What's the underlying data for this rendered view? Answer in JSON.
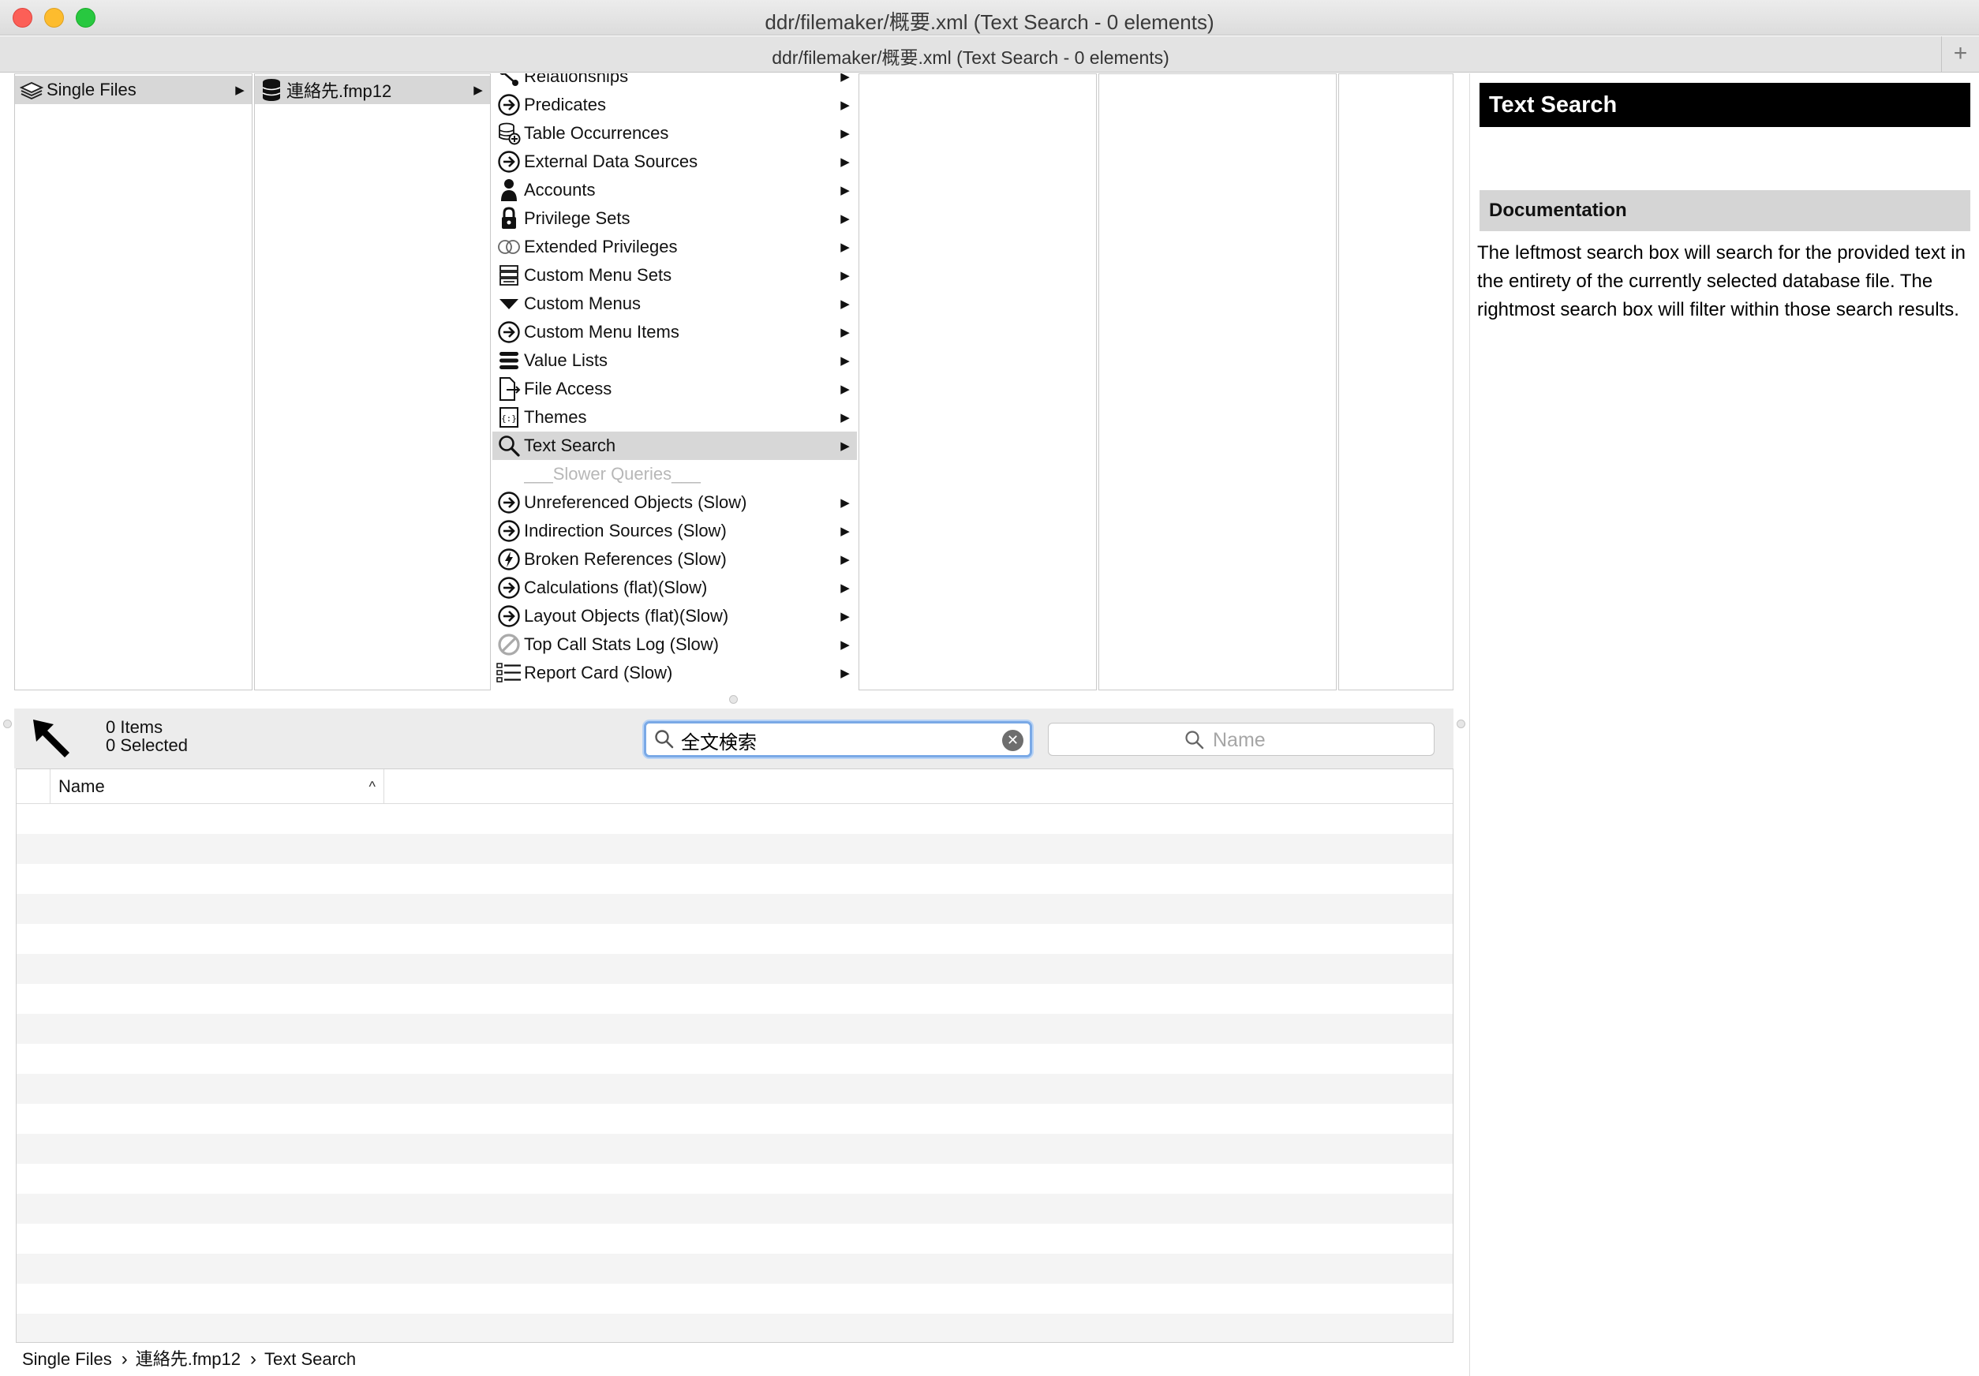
{
  "window": {
    "title": "ddr/filemaker/概要.xml  (Text Search - 0 elements)",
    "tab_title": "ddr/filemaker/概要.xml  (Text Search - 0 elements)",
    "new_tab_label": "+"
  },
  "columns": {
    "col1": [
      {
        "label": "Single Files",
        "icon": "stack-icon",
        "selected": true
      }
    ],
    "col2": [
      {
        "label": "連絡先.fmp12",
        "icon": "database-icon",
        "selected": true
      }
    ],
    "col3": [
      {
        "label": "Relationships",
        "icon": "relationships-icon"
      },
      {
        "label": "Predicates",
        "icon": "arrow-circle-icon"
      },
      {
        "label": "Table Occurrences",
        "icon": "table-occurrence-icon"
      },
      {
        "label": "External Data Sources",
        "icon": "arrow-circle-icon"
      },
      {
        "label": "Accounts",
        "icon": "person-icon"
      },
      {
        "label": "Privilege Sets",
        "icon": "lock-icon"
      },
      {
        "label": "Extended Privileges",
        "icon": "rings-icon"
      },
      {
        "label": "Custom Menu Sets",
        "icon": "menu-set-icon"
      },
      {
        "label": "Custom Menus",
        "icon": "triangle-down-icon"
      },
      {
        "label": "Custom Menu Items",
        "icon": "arrow-circle-icon"
      },
      {
        "label": "Value Lists",
        "icon": "list-icon"
      },
      {
        "label": "File Access",
        "icon": "file-access-icon"
      },
      {
        "label": "Themes",
        "icon": "theme-icon"
      },
      {
        "label": "Text Search",
        "icon": "search-icon",
        "selected": true
      },
      {
        "label": "___Slower Queries___",
        "disabled": true
      },
      {
        "label": "Unreferenced Objects (Slow)",
        "icon": "arrow-circle-icon"
      },
      {
        "label": "Indirection Sources (Slow)",
        "icon": "arrow-circle-icon"
      },
      {
        "label": "Broken References (Slow)",
        "icon": "lightning-circle-icon"
      },
      {
        "label": "Calculations (flat)(Slow)",
        "icon": "arrow-circle-icon"
      },
      {
        "label": "Layout Objects (flat)(Slow)",
        "icon": "arrow-circle-icon"
      },
      {
        "label": "Top Call Stats Log (Slow)",
        "icon": "prohibited-icon"
      },
      {
        "label": "Report Card (Slow)",
        "icon": "checklist-icon"
      }
    ],
    "arrow_glyph": "▶"
  },
  "toolbar": {
    "items_count": "0 Items",
    "selected_count": "0 Selected",
    "full_search_value": "全文検索",
    "filter_placeholder": "Name"
  },
  "table": {
    "columns": [
      "Name"
    ],
    "sort_indicator": "^",
    "rows": []
  },
  "inspector": {
    "title": "Text Search",
    "doc_header": "Documentation",
    "doc_text": "The leftmost search box will search for the provided text in the entirety of the currently selected database file. The rightmost search box will filter within those search results."
  },
  "pathbar": {
    "crumbs": [
      "Single Files",
      "連絡先.fmp12",
      "Text Search"
    ],
    "separator": "›"
  },
  "colors": {
    "selection": "#d7d7d7",
    "search_focus": "#7aa9e6",
    "stripe": "#f4f4f4",
    "inspector_title_bg": "#000000"
  }
}
